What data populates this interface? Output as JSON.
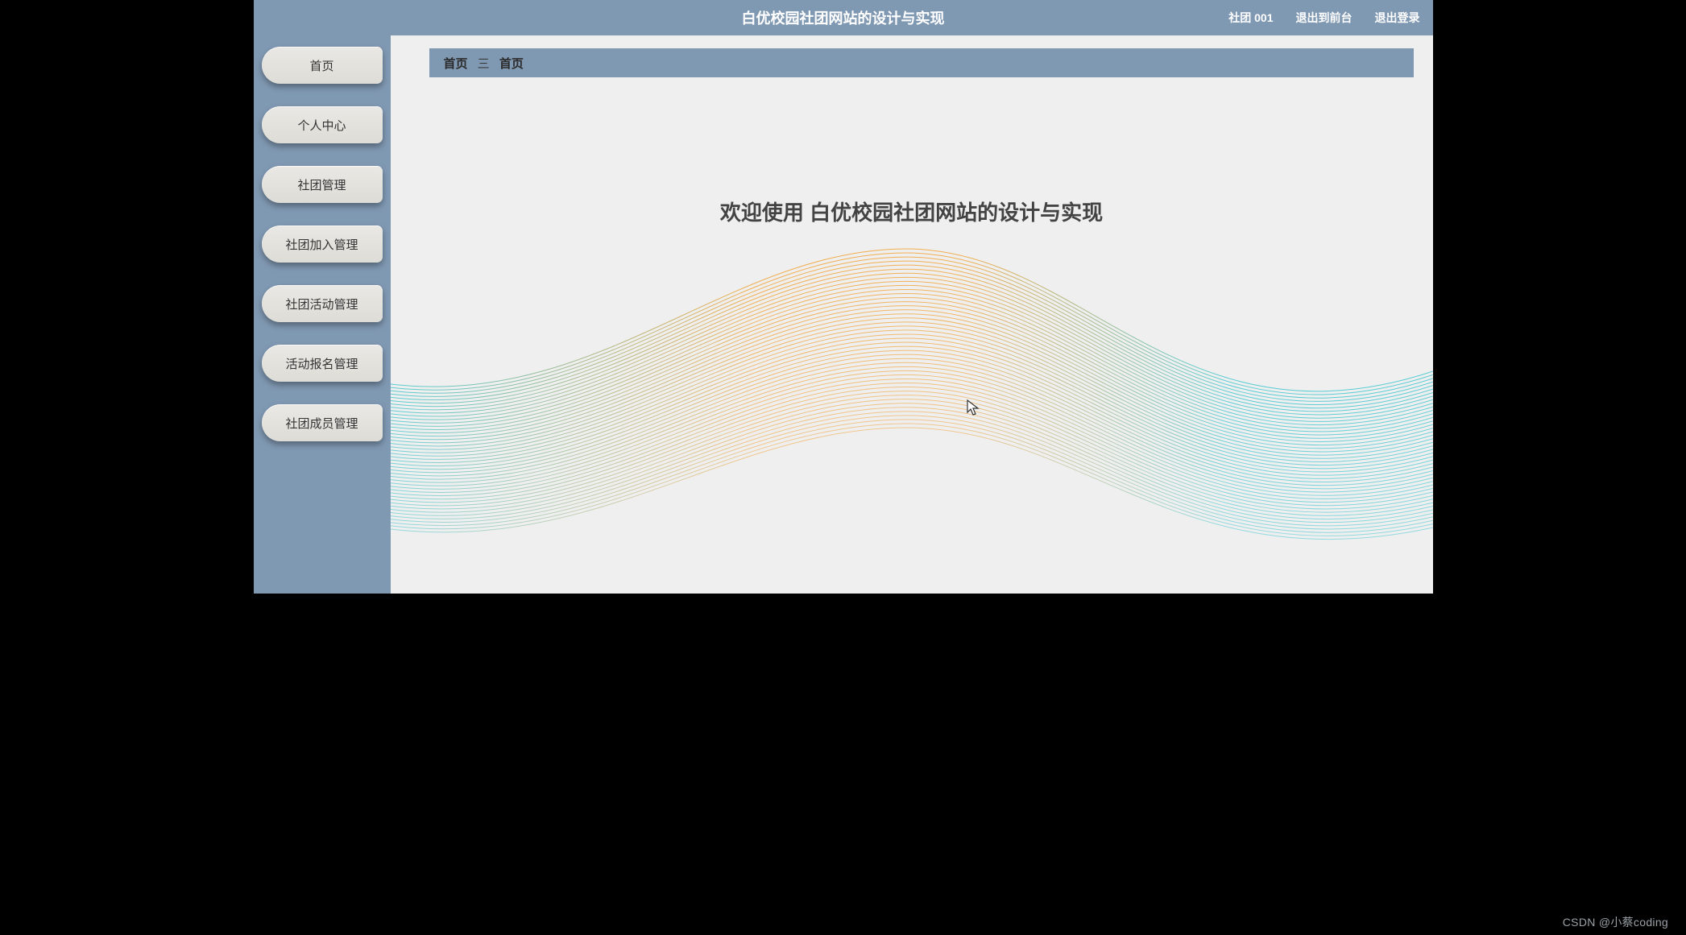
{
  "header": {
    "title": "白优校园社团网站的设计与实现",
    "user_label": "社团 001",
    "to_front": "退出到前台",
    "logout": "退出登录"
  },
  "sidebar": {
    "items": [
      {
        "label": "首页"
      },
      {
        "label": "个人中心"
      },
      {
        "label": "社团管理"
      },
      {
        "label": "社团加入管理"
      },
      {
        "label": "社团活动管理"
      },
      {
        "label": "活动报名管理"
      },
      {
        "label": "社团成员管理"
      }
    ]
  },
  "breadcrumb": {
    "root": "首页",
    "current": "首页"
  },
  "main": {
    "welcome": "欢迎使用 白优校园社团网站的设计与实现"
  },
  "watermark": "CSDN @小蔡coding",
  "colors": {
    "brand_blue": "#8099b3",
    "bg": "#efeff0",
    "wave_cyan": "#45c8cf",
    "wave_orange": "#f2a63b"
  }
}
